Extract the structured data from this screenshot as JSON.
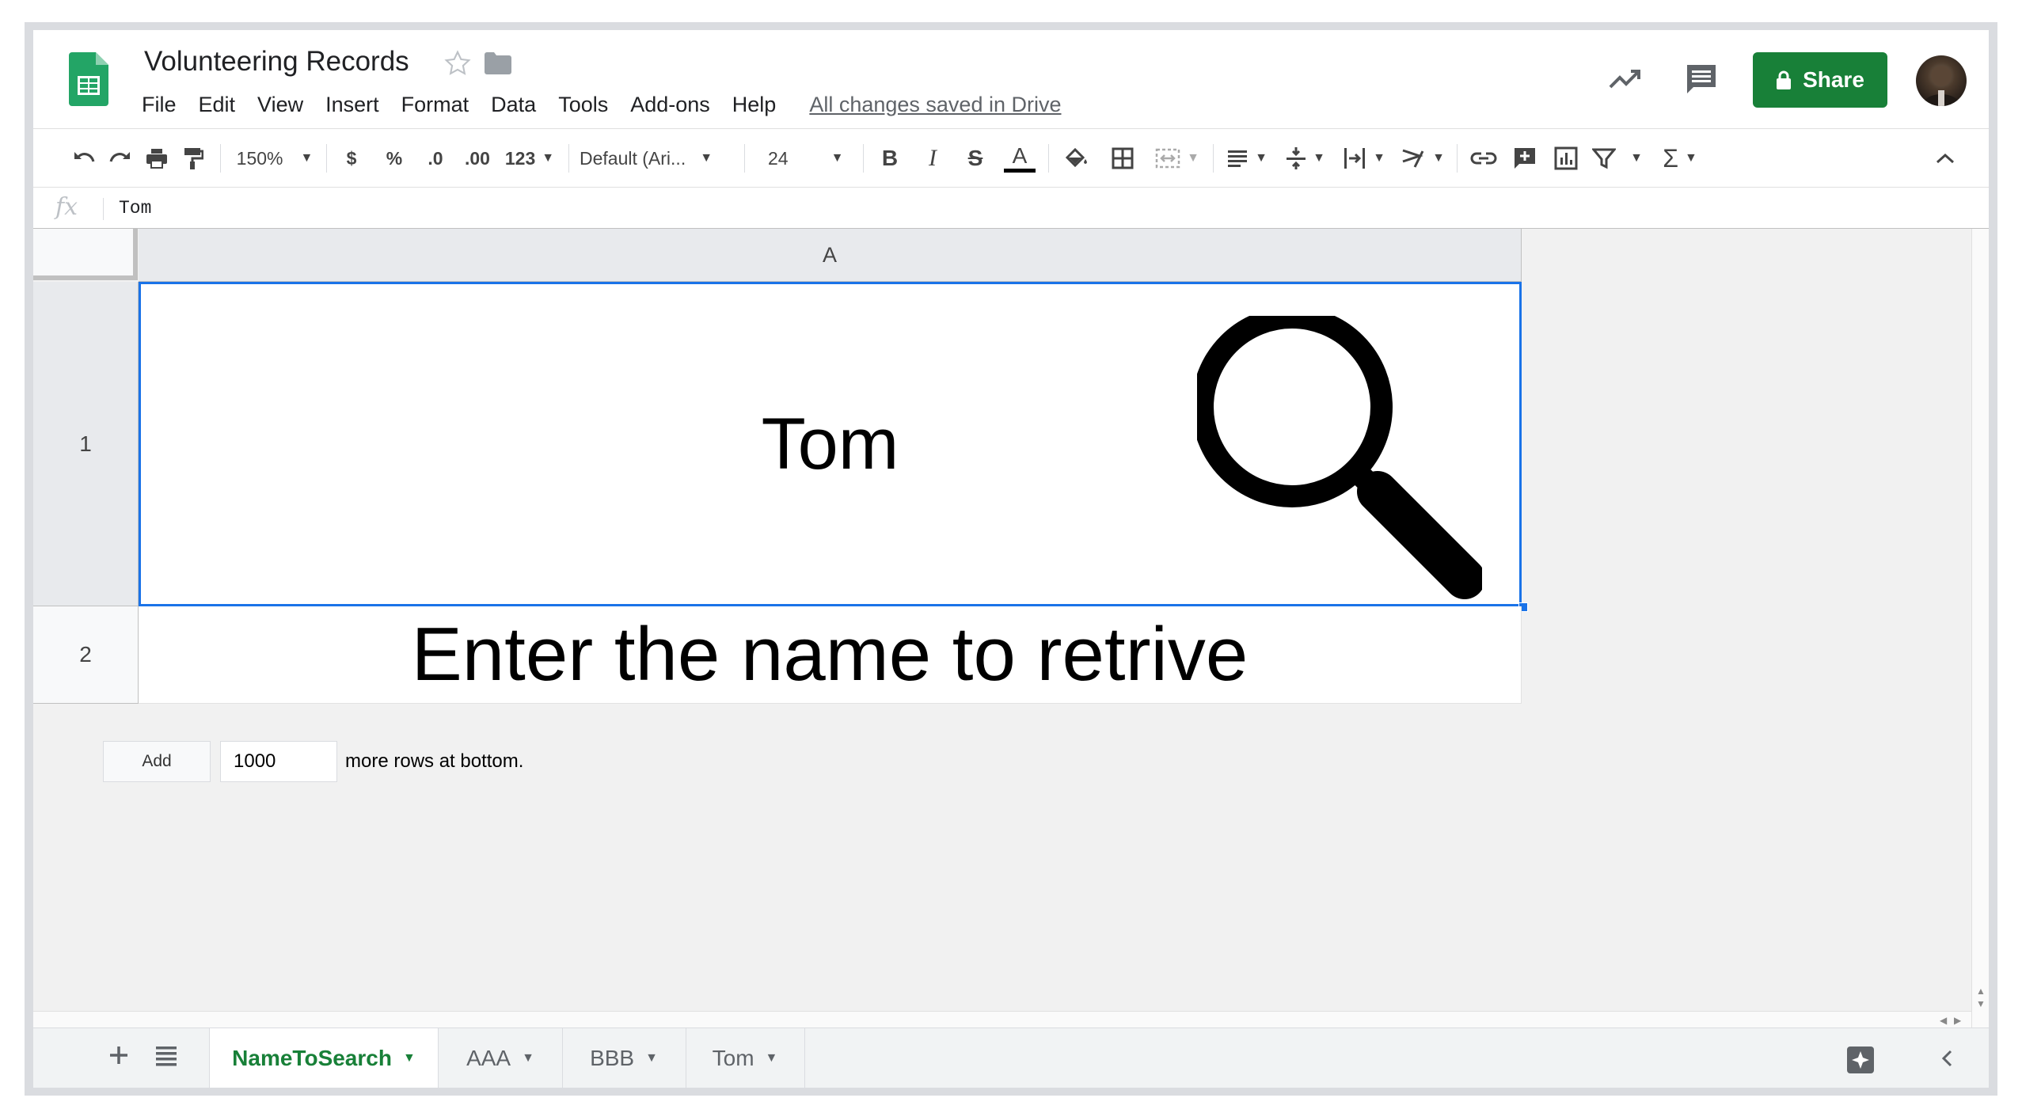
{
  "header": {
    "title": "Volunteering Records",
    "menu": [
      "File",
      "Edit",
      "View",
      "Insert",
      "Format",
      "Data",
      "Tools",
      "Add-ons",
      "Help"
    ],
    "save_status": "All changes saved in Drive",
    "share_label": "Share"
  },
  "toolbar": {
    "zoom": "150%",
    "currency": "$",
    "percent": "%",
    "decrease_decimal": ".0",
    "increase_decimal": ".00",
    "more_formats": "123",
    "font": "Default (Ari...",
    "font_size": "24",
    "bold": "B",
    "italic": "I",
    "strike": "S",
    "text_color": "A"
  },
  "formula_bar": {
    "fx": "fx",
    "value": "Tom"
  },
  "grid": {
    "column_header": "A",
    "rows": [
      {
        "number": "1",
        "value": "Tom"
      },
      {
        "number": "2",
        "value": "Enter the name to retrive"
      }
    ],
    "add_rows": {
      "button": "Add",
      "count": "1000",
      "label": "more rows at bottom."
    }
  },
  "sheets": {
    "tabs": [
      "NameToSearch",
      "AAA",
      "BBB",
      "Tom"
    ],
    "active_tab": "NameToSearch"
  },
  "colors": {
    "brand_green": "#188038",
    "selection_blue": "#1a73e8"
  }
}
